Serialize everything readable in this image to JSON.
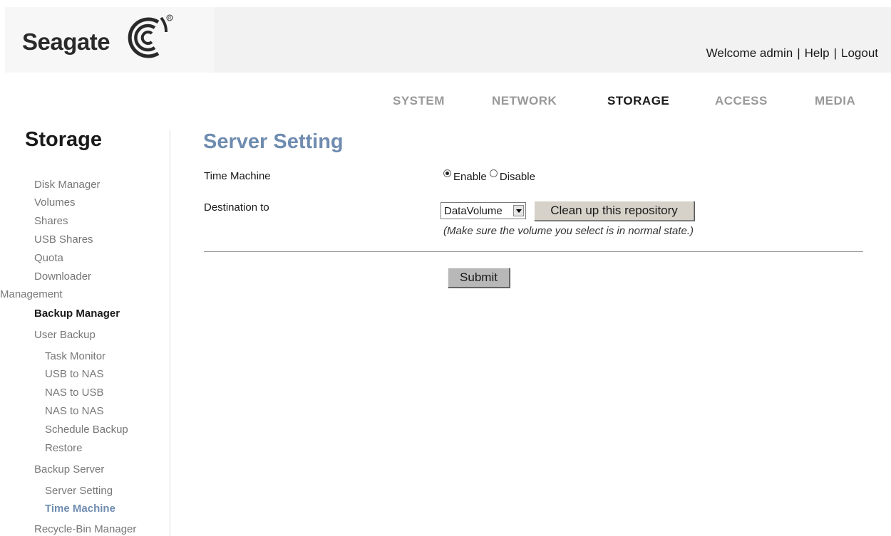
{
  "header": {
    "logo_text": "Seagate",
    "welcome": "Welcome admin",
    "help": "Help",
    "logout": "Logout",
    "separator": "|"
  },
  "topnav": {
    "tabs": [
      {
        "label": "SYSTEM",
        "active": false
      },
      {
        "label": "NETWORK",
        "active": false
      },
      {
        "label": "STORAGE",
        "active": true
      },
      {
        "label": "ACCESS",
        "active": false
      },
      {
        "label": "MEDIA",
        "active": false
      }
    ]
  },
  "sidebar": {
    "title": "Storage",
    "items": [
      {
        "label": "Disk Manager"
      },
      {
        "label": "Volumes"
      },
      {
        "label": "Shares"
      },
      {
        "label": "USB Shares"
      },
      {
        "label": "Quota"
      },
      {
        "label": "Downloader"
      },
      {
        "label": "Management"
      },
      {
        "label": "Backup Manager",
        "state": "bold"
      },
      {
        "label": "User Backup"
      },
      {
        "label": "Task Monitor"
      },
      {
        "label": "USB to NAS"
      },
      {
        "label": "NAS to USB"
      },
      {
        "label": "NAS to NAS"
      },
      {
        "label": "Schedule Backup"
      },
      {
        "label": "Restore"
      },
      {
        "label": "Backup Server"
      },
      {
        "label": "Server Setting"
      },
      {
        "label": "Time Machine",
        "state": "current"
      },
      {
        "label": "Recycle-Bin Manager"
      }
    ]
  },
  "main": {
    "title": "Server Setting",
    "time_machine_label": "Time Machine",
    "enable_label": "Enable",
    "disable_label": "Disable",
    "selected_option": "Enable",
    "destination_label": "Destination to",
    "destination_value": "DataVolume",
    "clean_button": "Clean up this repository",
    "hint": "(Make sure the volume you select is in normal state.)",
    "submit_button": "Submit"
  },
  "colors": {
    "accent": "#6f8cb0",
    "inactive_tab": "#999999",
    "sidebar_text": "#777777",
    "button_bg": "#d7d2c9"
  }
}
